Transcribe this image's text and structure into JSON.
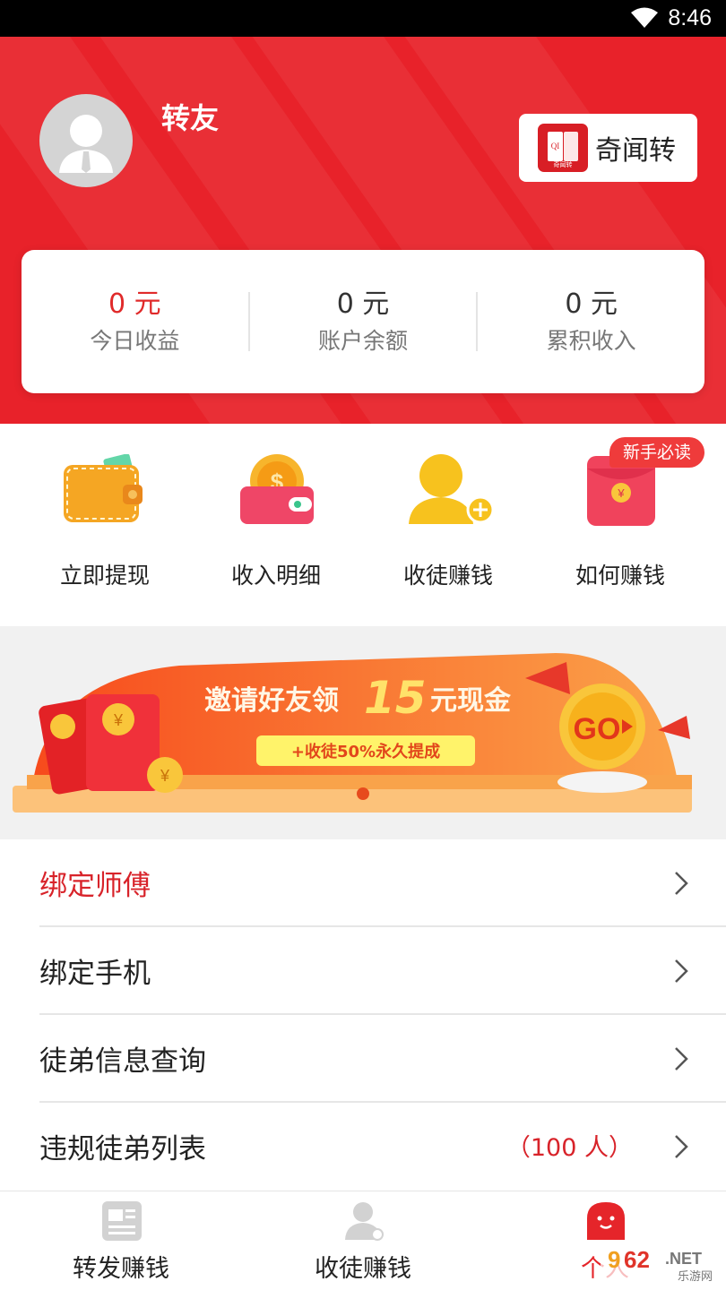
{
  "status_bar": {
    "time": "8:46"
  },
  "header": {
    "username": "转友",
    "brand": {
      "name": "奇闻转",
      "logo_letters": "QI",
      "logo_sub": "奇闻转"
    }
  },
  "stats": [
    {
      "value": "0 元",
      "label": "今日收益"
    },
    {
      "value": "0 元",
      "label": "账户余额"
    },
    {
      "value": "0 元",
      "label": "累积收入"
    }
  ],
  "quick_menu": {
    "badge": "新手必读",
    "items": [
      {
        "label": "立即提现",
        "icon": "wallet-icon"
      },
      {
        "label": "收入明细",
        "icon": "coin-wallet-icon"
      },
      {
        "label": "收徒赚钱",
        "icon": "add-user-icon"
      },
      {
        "label": "如何赚钱",
        "icon": "red-envelope-icon"
      }
    ]
  },
  "banner": {
    "headline_a": "邀请好友领",
    "headline_num": "15",
    "headline_b": "元现金",
    "subline": "+收徒50%永久提成",
    "go": "GO",
    "coin_symbol": "¥"
  },
  "menu": [
    {
      "label": "绑定师傅",
      "extra": ""
    },
    {
      "label": "绑定手机",
      "extra": ""
    },
    {
      "label": "徒弟信息查询",
      "extra": ""
    },
    {
      "label": "违规徒弟列表",
      "extra": "（100 人）"
    }
  ],
  "tabbar": [
    {
      "label": "转发赚钱",
      "icon": "news-icon",
      "active": false
    },
    {
      "label": "收徒赚钱",
      "icon": "user-icon",
      "active": false
    },
    {
      "label": "个人",
      "icon": "ghost-icon",
      "active": true
    }
  ],
  "watermark": {
    "brand_a": "9",
    "brand_b": "62",
    "tld": ".NET",
    "cn": "乐游网"
  },
  "colors": {
    "brand_red": "#e8222a",
    "accent_red": "#d8232a",
    "banner_orange": "#f7631c"
  }
}
